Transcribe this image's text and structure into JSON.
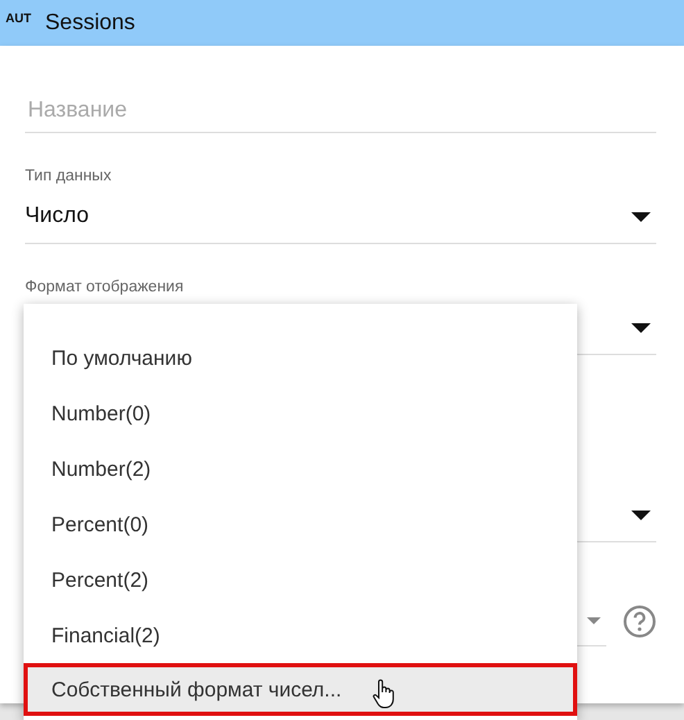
{
  "header": {
    "badge": "AUT",
    "title": "Sessions"
  },
  "fields": [
    {
      "kind": "text",
      "placeholder": "Название"
    },
    {
      "kind": "select",
      "label": "Тип данных",
      "value": "Число"
    },
    {
      "kind": "select",
      "label": "Формат отображения"
    },
    {
      "kind": "select"
    },
    {
      "kind": "select-help"
    }
  ],
  "menu": {
    "items": [
      {
        "label": "По умолчанию",
        "highlighted": false
      },
      {
        "label": "Number(0)",
        "highlighted": false
      },
      {
        "label": "Number(2)",
        "highlighted": false
      },
      {
        "label": "Percent(0)",
        "highlighted": false
      },
      {
        "label": "Percent(2)",
        "highlighted": false
      },
      {
        "label": "Financial(2)",
        "highlighted": false
      },
      {
        "label": "Собственный формат чисел...",
        "highlighted": true
      }
    ]
  }
}
